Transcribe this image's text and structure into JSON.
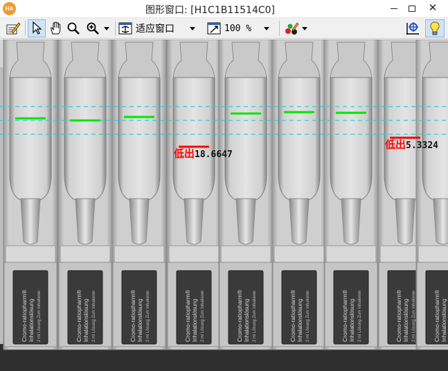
{
  "window": {
    "logo": "HA",
    "title": "图形窗口: [H1C1B11514C0]",
    "minimize_icon": "minimize-icon",
    "maximize_icon": "maximize-icon",
    "close_icon": "close-icon",
    "close_glyph": "✕"
  },
  "toolbar": {
    "tools": [
      "edit-settings-icon",
      "pointer-icon",
      "pan-hand-icon",
      "magnifier-icon",
      "zoom-in-icon",
      "fit-window-icon",
      "zoom-percent-icon",
      "color-palette-icon",
      "crosshair-icon",
      "lightbulb-icon"
    ],
    "fit_mode": "适应窗口",
    "zoom_level": "100 %"
  },
  "colors": {
    "liquid_level_ok": "#00e600",
    "liquid_level_low": "#ff0000",
    "reference_lines": "#22d3d8",
    "low_text": "#ff0000"
  },
  "label_text": {
    "line1": "Cromo-ratiopharm®",
    "line2": "Inhalationslösung",
    "line3": "2 ml Lösung  Zum Inhalieren"
  },
  "vials": [
    {
      "index": 1,
      "status": "ok"
    },
    {
      "index": 2,
      "status": "ok"
    },
    {
      "index": 3,
      "status": "ok"
    },
    {
      "index": 4,
      "status": "low",
      "status_label": "低出",
      "value": "18.6647"
    },
    {
      "index": 5,
      "status": "ok"
    },
    {
      "index": 6,
      "status": "ok"
    },
    {
      "index": 7,
      "status": "ok"
    },
    {
      "index": 8,
      "status": "low",
      "status_label": "低出",
      "value": "5.3324"
    },
    {
      "index": 9,
      "status": "ok"
    }
  ]
}
